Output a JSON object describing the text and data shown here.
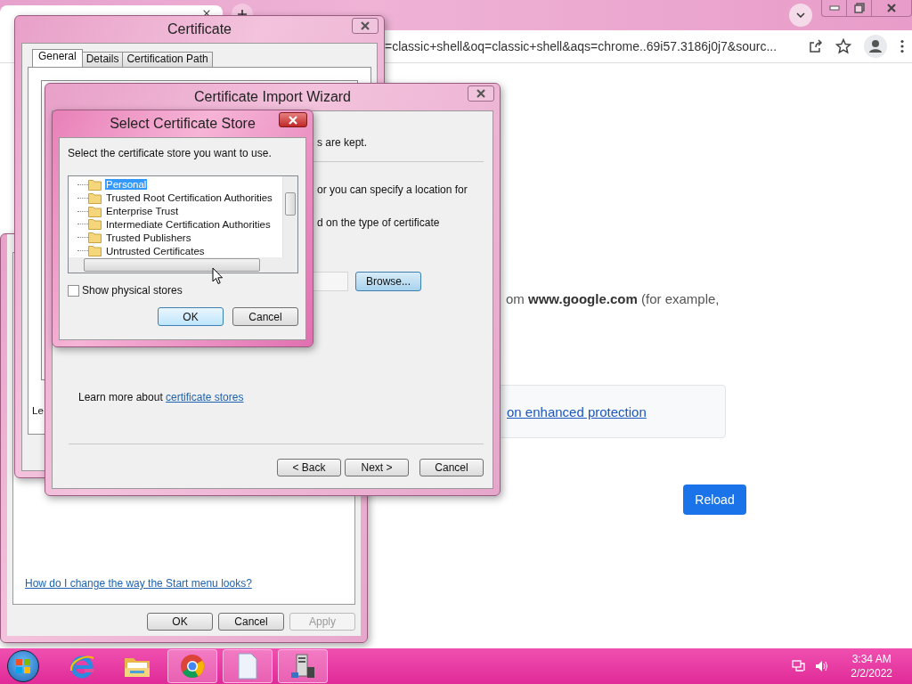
{
  "browser": {
    "address_bar": {
      "url": "=classic+shell&oq=classic+shell&aqs=chrome..69i57.3186j0j7&sourc..."
    },
    "page": {
      "message": "om **www.google.com** (for example,",
      "protection_link": "on enhanced protection",
      "reload_button": "Reload"
    }
  },
  "taskbar_properties": {
    "help_link": "How do I change the way the Start menu looks?",
    "buttons": [
      {
        "label": "OK",
        "disabled": false
      },
      {
        "label": "Cancel",
        "disabled": false
      },
      {
        "label": "Apply",
        "disabled": true
      }
    ]
  },
  "certificate": {
    "title": "Certificate",
    "tabs": [
      {
        "label": "General",
        "selected": true
      },
      {
        "label": "Details",
        "selected": false
      },
      {
        "label": "Certification Path",
        "selected": false
      }
    ],
    "fragment": "Le"
  },
  "import_wizard": {
    "title": "Certificate Import Wizard",
    "text_1": "s are kept.",
    "text_2": "or you can specify a location for",
    "text_3": "d on the type of certificate",
    "browse_button": "Browse...",
    "learn_more": "Learn more about",
    "learn_more_link": "certificate stores",
    "buttons": [
      {
        "label": "< Back"
      },
      {
        "label": "Next >"
      },
      {
        "label": "Cancel"
      }
    ]
  },
  "store_dialog": {
    "title": "Select Certificate Store",
    "prompt": "Select the certificate store you want to use.",
    "stores": [
      {
        "label": "Personal",
        "selected": true
      },
      {
        "label": "Trusted Root Certification Authorities",
        "selected": false
      },
      {
        "label": "Enterprise Trust",
        "selected": false
      },
      {
        "label": "Intermediate Certification Authorities",
        "selected": false
      },
      {
        "label": "Trusted Publishers",
        "selected": false
      },
      {
        "label": "Untrusted Certificates",
        "selected": false
      }
    ],
    "show_physical_stores": {
      "label": "Show physical stores",
      "checked": false
    },
    "buttons": [
      {
        "label": "OK",
        "default": true
      },
      {
        "label": "Cancel",
        "default": false
      }
    ]
  },
  "taskbar": {
    "apps": [
      {
        "kind": "ie",
        "open": false
      },
      {
        "kind": "explorer",
        "open": false
      },
      {
        "kind": "chrome",
        "open": true
      },
      {
        "kind": "document",
        "open": true
      },
      {
        "kind": "server",
        "open": true
      }
    ],
    "clock": {
      "time": "3:34 AM",
      "date": "2/2/2022"
    }
  }
}
